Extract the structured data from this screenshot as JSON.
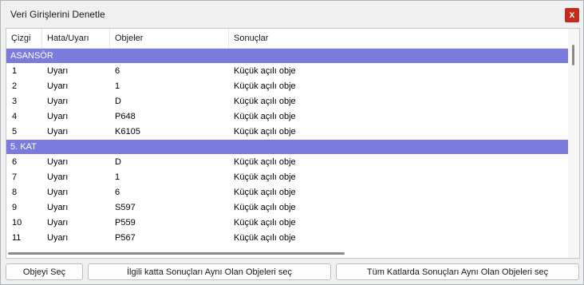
{
  "window": {
    "title": "Veri Girişlerini Denetle",
    "close_glyph": "x"
  },
  "columns": [
    "Çizgi",
    "Hata/Uyarı",
    "Objeler",
    "Sonuçlar"
  ],
  "groups": [
    {
      "name": "ASANSÖR",
      "rows": [
        {
          "line": "1",
          "type": "Uyarı",
          "object": "6",
          "result": "Küçük açılı obje"
        },
        {
          "line": "2",
          "type": "Uyarı",
          "object": "1",
          "result": "Küçük açılı obje"
        },
        {
          "line": "3",
          "type": "Uyarı",
          "object": "D",
          "result": "Küçük açılı obje"
        },
        {
          "line": "4",
          "type": "Uyarı",
          "object": "P648",
          "result": "Küçük açılı obje"
        },
        {
          "line": "5",
          "type": "Uyarı",
          "object": "K6105",
          "result": "Küçük açılı obje"
        }
      ]
    },
    {
      "name": "5. KAT",
      "rows": [
        {
          "line": "6",
          "type": "Uyarı",
          "object": "D",
          "result": "Küçük açılı obje"
        },
        {
          "line": "7",
          "type": "Uyarı",
          "object": "1",
          "result": "Küçük açılı obje"
        },
        {
          "line": "8",
          "type": "Uyarı",
          "object": "6",
          "result": "Küçük açılı obje"
        },
        {
          "line": "9",
          "type": "Uyarı",
          "object": "S597",
          "result": "Küçük açılı obje"
        },
        {
          "line": "10",
          "type": "Uyarı",
          "object": "P559",
          "result": "Küçük açılı obje"
        },
        {
          "line": "11",
          "type": "Uyarı",
          "object": "P567",
          "result": "Küçük açılı obje"
        }
      ]
    }
  ],
  "buttons": {
    "select_object": "Objeyi Seç",
    "select_same_floor": "İlgili katta Sonuçları Aynı Olan Objeleri seç",
    "select_all_floors": "Tüm Katlarda Sonuçları Aynı Olan Objeleri seç"
  },
  "colors": {
    "group_row": "#7b7bdd",
    "close_button": "#c42b1c"
  }
}
